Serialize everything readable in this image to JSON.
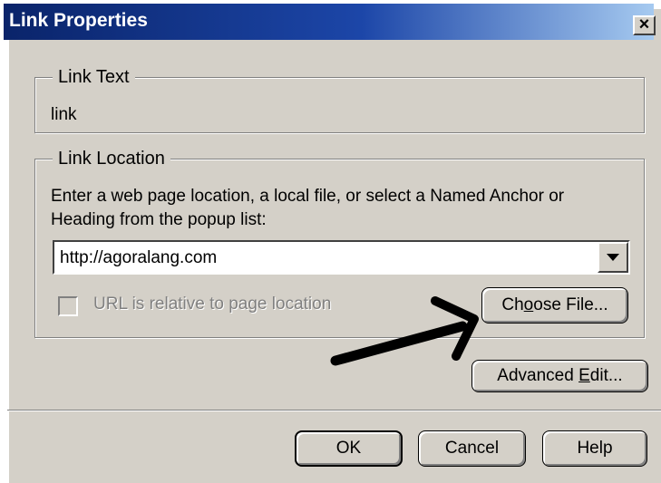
{
  "window": {
    "title": "Link Properties",
    "close_glyph": "×"
  },
  "link_text": {
    "legend": "Link Text",
    "value": "link"
  },
  "link_location": {
    "legend": "Link Location",
    "instructions_line1": "Enter a web page location, a local file, or select a Named Anchor or",
    "instructions_line2": "Heading from the popup list:",
    "url_value": "http://agoralang.com",
    "relative_checkbox_label": "URL is relative to page location",
    "relative_checked": false,
    "choose_file": {
      "before": "Ch",
      "accel": "o",
      "after": "ose File..."
    }
  },
  "advanced_edit": {
    "before": "Advanced ",
    "accel": "E",
    "after": "dit..."
  },
  "buttons": {
    "ok": "OK",
    "cancel": "Cancel",
    "help": "Help"
  },
  "annotation": {
    "arrow_color": "#000000"
  },
  "colors": {
    "dialog_bg": "#d4d0c8",
    "titlebar_start": "#0a246a",
    "titlebar_end": "#a6caf0"
  }
}
